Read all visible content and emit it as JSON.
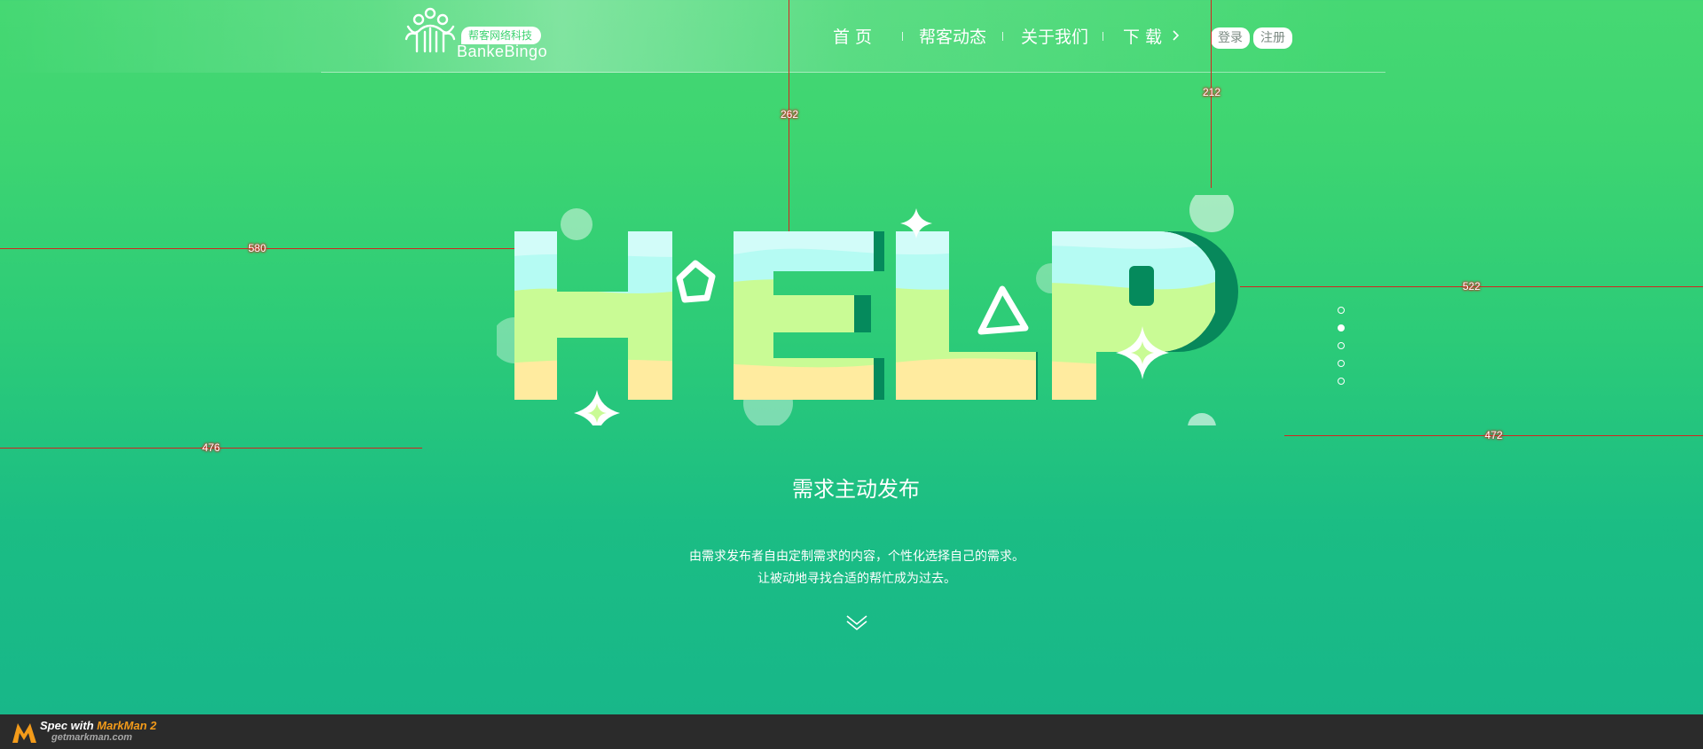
{
  "header": {
    "logo_tag": "帮客网络科技",
    "logo_word": "BankeBingo",
    "nav": [
      {
        "label": "首  页"
      },
      {
        "label": "帮客动态"
      },
      {
        "label": "关于我们"
      },
      {
        "label": "下  载"
      }
    ],
    "login_label": "登录",
    "register_label": "注册"
  },
  "hero": {
    "big_word": "HELP",
    "headline": "需求主动发布",
    "desc_line1": "由需求发布者自由定制需求的内容，个性化选择自己的需求。",
    "desc_line2": "让被动地寻找合适的帮忙成为过去。"
  },
  "pagination": {
    "count": 5,
    "active_index": 1
  },
  "measurements": [
    {
      "label": "580"
    },
    {
      "label": "262"
    },
    {
      "label": "212"
    },
    {
      "label": "522"
    },
    {
      "label": "476"
    },
    {
      "label": "472"
    }
  ],
  "footer": {
    "spec_prefix": "Spec with ",
    "spec_brand": "MarkMan 2",
    "url": "getmarkman.com"
  },
  "colors": {
    "bg_top": "#46d873",
    "bg_bottom": "#17b68a",
    "letter_dark": "#058a5c",
    "letter_cyan": "#b5fbf3",
    "letter_lime": "#c9fb95",
    "letter_sand": "#ffeb9f",
    "measure_red": "#d2261f"
  }
}
